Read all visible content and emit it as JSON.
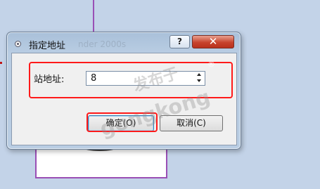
{
  "dialog": {
    "title": "指定地址",
    "title_ghost": "nder 2000s",
    "help_label": "?",
    "close_label": "✕",
    "field_label": "站地址:",
    "field_value": "8",
    "ok_label": "确定(O)",
    "cancel_label": "取消(C)"
  },
  "watermark": {
    "chinese": "发布于",
    "latin": "gongkong",
    "registered": "®"
  },
  "icons": [
    "app-icon",
    "spin-up-icon",
    "spin-down-icon"
  ],
  "colors": {
    "highlight": "#ff1a1a",
    "background": "#c3d3e8",
    "close_button": "#c7432d",
    "accent_line": "#9a4fb5"
  }
}
